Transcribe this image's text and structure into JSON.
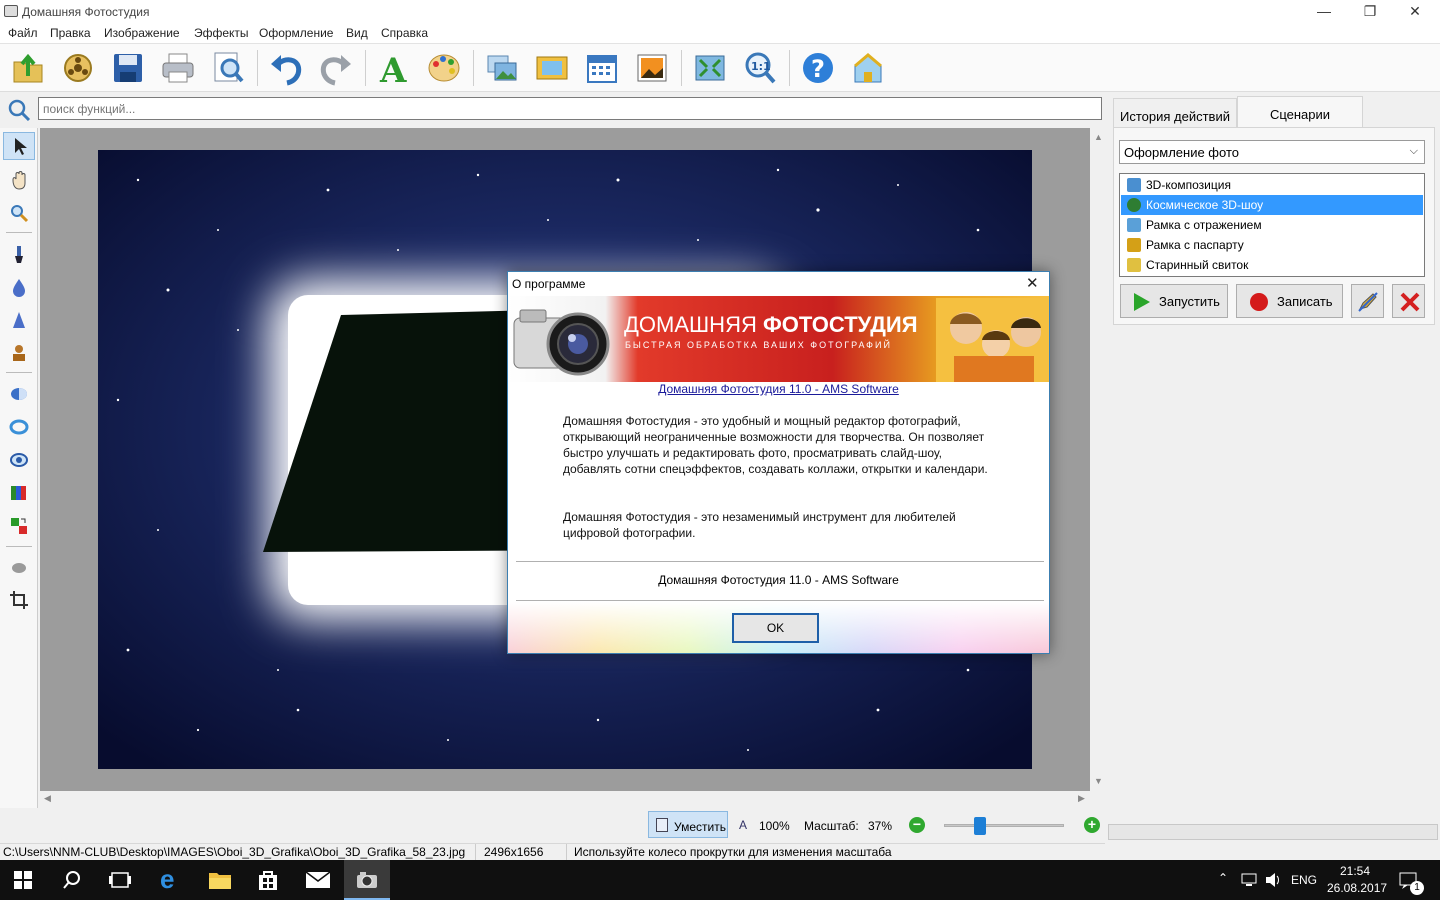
{
  "window": {
    "title": "Домашняя Фотостудия",
    "minimize": "—",
    "restore": "❐",
    "close": "✕"
  },
  "menu": [
    "Файл",
    "Правка",
    "Изображение",
    "Эффекты",
    "Оформление",
    "Вид",
    "Справка"
  ],
  "toolbar_icons": [
    "open-folder-icon",
    "film-reel-icon",
    "save-icon",
    "print-icon",
    "preview-icon",
    "undo-icon",
    "redo-icon",
    "text-icon",
    "palette-icon",
    "images-icon",
    "frame-icon",
    "calendar-icon",
    "postcard-icon",
    "fit-icon",
    "zoom-1-1-icon",
    "help-icon",
    "home-icon"
  ],
  "search": {
    "placeholder": "поиск функций..."
  },
  "right_panel": {
    "tabs": [
      "История действий",
      "Сценарии"
    ],
    "active_tab": 1,
    "select_value": "Оформление фото",
    "items": [
      {
        "label": "3D-композиция",
        "selected": false,
        "color": "#4a8fd0"
      },
      {
        "label": "Космическое 3D-шоу",
        "selected": true,
        "color": "#2e7d32"
      },
      {
        "label": "Рамка с отражением",
        "selected": false,
        "color": "#5aa0d8"
      },
      {
        "label": "Рамка с паспарту",
        "selected": false,
        "color": "#d4a017"
      },
      {
        "label": "Старинный свиток",
        "selected": false,
        "color": "#e0c040"
      }
    ],
    "run_label": "Запустить",
    "record_label": "Записать"
  },
  "zoombar": {
    "fit_label": "Уместить",
    "hundred_label": "100%",
    "scale_label": "Масштаб:",
    "scale_value": "37%",
    "slider_fraction": 0.27
  },
  "status": {
    "path": "C:\\Users\\NNM-CLUB\\Desktop\\IMAGES\\Oboi_3D_Grafika\\Oboi_3D_Grafika_58_23.jpg",
    "size": "2496x1656",
    "hint": "Используйте колесо прокрутки для изменения масштаба"
  },
  "dialog": {
    "title": "О программе",
    "close": "✕",
    "banner_title_a": "ДОМАШНЯЯ",
    "banner_title_b": "ФОТОСТУДИЯ",
    "banner_subtitle": "БЫСТРАЯ ОБРАБОТКА ВАШИХ ФОТОГРАФИЙ",
    "link": "Домашняя Фотостудия 11.0 - AMS Software",
    "para1": "Домашняя Фотостудия - это удобный и мощный редактор фотографий, открывающий неограниченные возможности для творчества. Он позволяет быстро улучшать и редактировать фото, просматривать слайд-шоу, добавлять сотни спецэффектов, создавать коллажи, открытки и календари.",
    "para2": "Домашняя Фотостудия - это незаменимый инструмент для любителей цифровой фотографии.",
    "version": "Домашняя Фотостудия 11.0 - AMS Software",
    "ok_label": "OK"
  },
  "taskbar": {
    "lang": "ENG",
    "time": "21:54",
    "date": "26.08.2017",
    "notif_count": "1"
  }
}
